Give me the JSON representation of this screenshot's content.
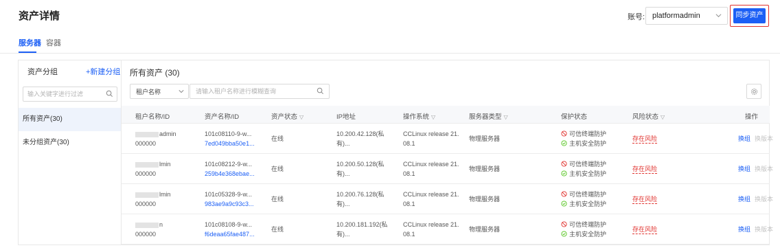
{
  "header": {
    "title": "资产详情",
    "account_label": "账号:",
    "account_value": "platformadmin",
    "sync_button": "同步资产"
  },
  "tabs": [
    {
      "label": "服务器",
      "active": true
    },
    {
      "label": "容器",
      "active": false
    }
  ],
  "groups": {
    "title": "资产分组",
    "add_label": "+新建分组",
    "search_placeholder": "输入关键字进行过滤",
    "items": [
      {
        "label": "所有资产(30)",
        "selected": true
      },
      {
        "label": "未分组资产(30)",
        "selected": false
      }
    ]
  },
  "assets": {
    "title": "所有资产 (30)",
    "filter_select": "租户名称",
    "filter_placeholder": "请输入租户名称进行模糊查询",
    "columns": [
      "租户名称/ID",
      "资产名称/ID",
      "资产状态",
      "IP地址",
      "操作系统",
      "服务器类型",
      "保护状态",
      "风险状态",
      "操作"
    ],
    "rows": [
      {
        "tenant_name": "admin",
        "tenant_id": "000000",
        "asset_name": "101c08110-9-w...",
        "asset_id": "7ed049bba50e1...",
        "status": "在线",
        "ip": "10.200.42.128(私",
        "ip_suffix": "有)...",
        "os": "CCLinux release 21.",
        "os_suffix": "08.1",
        "server_type": "物理服务器",
        "prot1": "可信终端防护",
        "prot2": "主机安全防护",
        "risk": "存在风险",
        "op1": "换组",
        "op2": "换版本"
      },
      {
        "tenant_name": "lmin",
        "tenant_id": "000000",
        "asset_name": "101c08212-9-w...",
        "asset_id": "259b4e368ebae...",
        "status": "在线",
        "ip": "10.200.50.128(私",
        "ip_suffix": "有)...",
        "os": "CCLinux release 21.",
        "os_suffix": "08.1",
        "server_type": "物理服务器",
        "prot1": "可信终端防护",
        "prot2": "主机安全防护",
        "risk": "存在风险",
        "op1": "换组",
        "op2": "换版本"
      },
      {
        "tenant_name": "lmin",
        "tenant_id": "000000",
        "asset_name": "101c05328-9-w...",
        "asset_id": "983ae9a9c93c3...",
        "status": "在线",
        "ip": "10.200.76.128(私",
        "ip_suffix": "有)...",
        "os": "CCLinux release 21.",
        "os_suffix": "08.1",
        "server_type": "物理服务器",
        "prot1": "可信终端防护",
        "prot2": "主机安全防护",
        "risk": "存在风险",
        "op1": "换组",
        "op2": "换版本"
      },
      {
        "tenant_name": "n",
        "tenant_id": "000000",
        "asset_name": "101c08108-9-w...",
        "asset_id": "f6deaa65fae487...",
        "status": "在线",
        "ip": "10.200.181.192(私",
        "ip_suffix": "有)...",
        "os": "CCLinux release 21.",
        "os_suffix": "08.1",
        "server_type": "物理服务器",
        "prot1": "可信终端防护",
        "prot2": "主机安全防护",
        "risk": "存在风险",
        "op1": "换组",
        "op2": "换版本"
      }
    ]
  },
  "colors": {
    "primary": "#1c5ff5",
    "danger": "#e0302c",
    "success": "#52c41a"
  }
}
